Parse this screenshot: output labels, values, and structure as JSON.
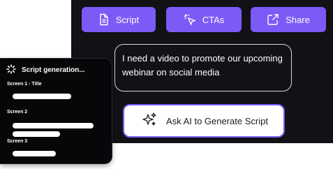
{
  "tabs": [
    {
      "label": "Script",
      "icon": "document-icon"
    },
    {
      "label": "CTAs",
      "icon": "cursor-click-icon"
    },
    {
      "label": "Share",
      "icon": "external-link-icon"
    }
  ],
  "prompt": {
    "text": "I need a video to promote our upcoming webinar on social media"
  },
  "ask_button": {
    "label": "Ask AI to Generate Script",
    "icon": "sparkles-icon"
  },
  "generation": {
    "title": "Script generation...",
    "icon": "loading-spinner-icon",
    "screens": [
      {
        "label": "Screen 1 - Title"
      },
      {
        "label": "Screen 2"
      },
      {
        "label": "Screen 3"
      }
    ]
  },
  "colors": {
    "accent": "#7c5af6",
    "panel_bg": "#111116",
    "card_bg": "#07070a"
  }
}
